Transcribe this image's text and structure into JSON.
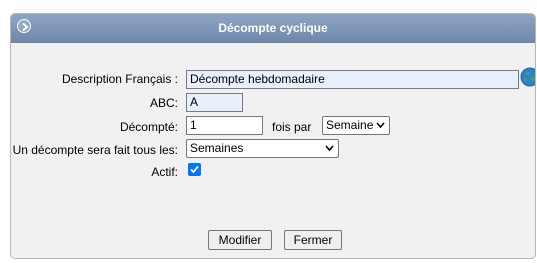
{
  "panel": {
    "title": "Décompte cyclique"
  },
  "form": {
    "description": {
      "label": "Description Français :",
      "value": "Décompte hebdomadaire"
    },
    "abc": {
      "label": "ABC:",
      "value": "A"
    },
    "decompte": {
      "label": "Décompté:",
      "value": "1",
      "suffix": "fois par",
      "unit": "Semaine"
    },
    "frequency": {
      "label": "Un décompte sera fait tous les:",
      "value": "Semaines"
    },
    "actif": {
      "label": "Actif:",
      "checked": true
    }
  },
  "buttons": {
    "modify": "Modifier",
    "close": "Fermer"
  },
  "icons": {
    "collapse": "circle-chevron-right-icon",
    "translate": "globe-icon"
  },
  "colors": {
    "header": "#7a93b5",
    "checkbox": "#0075ff",
    "input_highlight": "#e8f0fe"
  }
}
